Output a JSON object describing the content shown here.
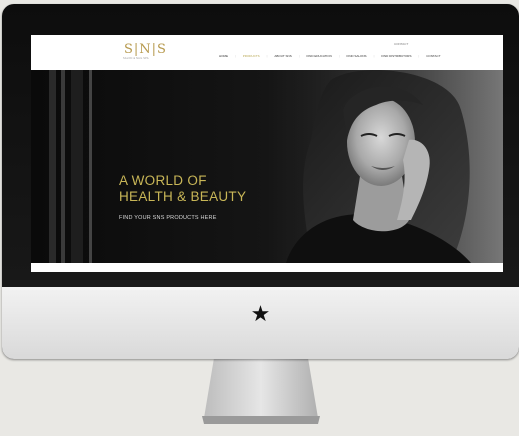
{
  "header": {
    "logo_text": "S|N|S",
    "tagline": "SALON & NAIL SPA",
    "top_link": "CONTACT",
    "nav": [
      {
        "label": "HOME",
        "active": false
      },
      {
        "label": "PRODUCTS",
        "active": true
      },
      {
        "label": "ABOUT SNS",
        "active": false
      },
      {
        "label": "FIND EDUCATION",
        "active": false
      },
      {
        "label": "FIND SALONS",
        "active": false
      },
      {
        "label": "FIND DISTRIBUTORS",
        "active": false
      },
      {
        "label": "CONTACT",
        "active": false
      }
    ]
  },
  "hero": {
    "title_line1": "A WORLD OF",
    "title_line2": "HEALTH & BEAUTY",
    "subtitle": "FIND YOUR SNS PRODUCTS HERE"
  },
  "device": {
    "chin_icon": "star-icon",
    "chin_glyph": "★"
  },
  "colors": {
    "accent_gold": "#c8b657",
    "hero_dark": "#0a0a0a",
    "page_bg": "#e9e8e4"
  }
}
